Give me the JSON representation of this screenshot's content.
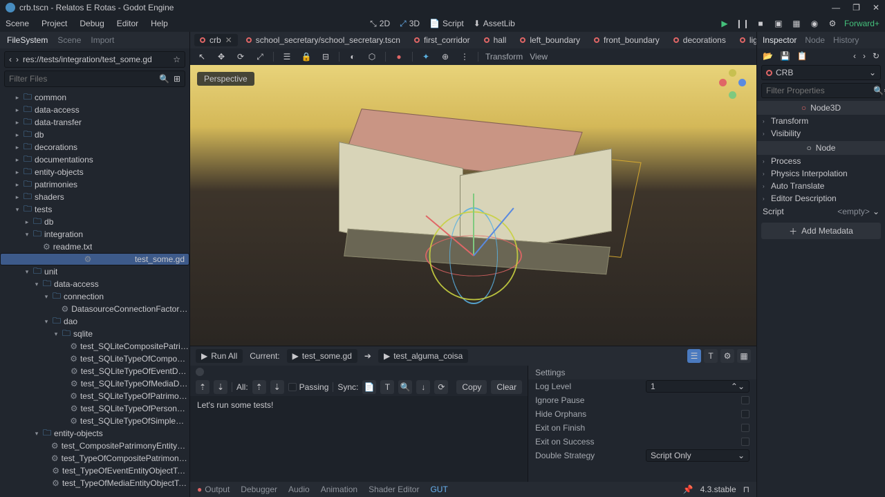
{
  "window_title": "crb.tscn - Relatos E Rotas - Godot Engine",
  "menubar": [
    "Scene",
    "Project",
    "Debug",
    "Editor",
    "Help"
  ],
  "workspace": {
    "items": [
      "2D",
      "3D",
      "Script",
      "AssetLib"
    ],
    "active": "3D"
  },
  "playbar": {
    "forward": "Forward+"
  },
  "left_dock": {
    "tabs": [
      "FileSystem",
      "Scene",
      "Import"
    ],
    "active": "FileSystem",
    "path": "res://tests/integration/test_some.gd",
    "filter_placeholder": "Filter Files"
  },
  "tree": [
    {
      "d": 1,
      "t": "folder",
      "o": false,
      "n": "common"
    },
    {
      "d": 1,
      "t": "folder",
      "o": false,
      "n": "data-access"
    },
    {
      "d": 1,
      "t": "folder",
      "o": false,
      "n": "data-transfer"
    },
    {
      "d": 1,
      "t": "folder",
      "o": false,
      "n": "db"
    },
    {
      "d": 1,
      "t": "folder",
      "o": false,
      "n": "decorations"
    },
    {
      "d": 1,
      "t": "folder",
      "o": false,
      "n": "documentations"
    },
    {
      "d": 1,
      "t": "folder",
      "o": false,
      "n": "entity-objects"
    },
    {
      "d": 1,
      "t": "folder",
      "o": false,
      "n": "patrimonies"
    },
    {
      "d": 1,
      "t": "folder",
      "o": false,
      "n": "shaders"
    },
    {
      "d": 1,
      "t": "folder",
      "o": true,
      "n": "tests"
    },
    {
      "d": 2,
      "t": "folder",
      "o": false,
      "n": "db"
    },
    {
      "d": 2,
      "t": "folder",
      "o": true,
      "n": "integration"
    },
    {
      "d": 3,
      "t": "file",
      "n": "readme.txt",
      "icon": "gear"
    },
    {
      "d": 3,
      "t": "file",
      "n": "test_some.gd",
      "icon": "gear",
      "sel": true
    },
    {
      "d": 2,
      "t": "folder",
      "o": true,
      "n": "unit"
    },
    {
      "d": 3,
      "t": "folder",
      "o": true,
      "n": "data-access"
    },
    {
      "d": 4,
      "t": "folder",
      "o": true,
      "n": "connection"
    },
    {
      "d": 5,
      "t": "file",
      "n": "DatasourceConnectionFactoryTest.gd",
      "icon": "gear"
    },
    {
      "d": 4,
      "t": "folder",
      "o": true,
      "n": "dao"
    },
    {
      "d": 5,
      "t": "folder",
      "o": true,
      "n": "sqlite"
    },
    {
      "d": 6,
      "t": "file",
      "n": "test_SQLiteCompositePatrimonyDAOT...",
      "icon": "gear"
    },
    {
      "d": 6,
      "t": "file",
      "n": "test_SQLiteTypeOfCompositePatrimon...",
      "icon": "gear"
    },
    {
      "d": 6,
      "t": "file",
      "n": "test_SQLiteTypeOfEventDAOTest.gd",
      "icon": "gear"
    },
    {
      "d": 6,
      "t": "file",
      "n": "test_SQLiteTypeOfMediaDAOTest.gd",
      "icon": "gear"
    },
    {
      "d": 6,
      "t": "file",
      "n": "test_SQLiteTypeOfPatrimonyDAOTest.gd",
      "icon": "gear"
    },
    {
      "d": 6,
      "t": "file",
      "n": "test_SQLiteTypeOfPersonDAOTest.gd",
      "icon": "gear"
    },
    {
      "d": 6,
      "t": "file",
      "n": "test_SQLiteTypeOfSimplePatrimonyDA...",
      "icon": "gear"
    },
    {
      "d": 3,
      "t": "folder",
      "o": true,
      "n": "entity-objects"
    },
    {
      "d": 4,
      "t": "file",
      "n": "test_CompositePatrimonyEntityObjectTest...",
      "icon": "gear"
    },
    {
      "d": 4,
      "t": "file",
      "n": "test_TypeOfCompositePatrimonyEntityObj...",
      "icon": "gear"
    },
    {
      "d": 4,
      "t": "file",
      "n": "test_TypeOfEventEntityObjectTest.gd",
      "icon": "gear"
    },
    {
      "d": 4,
      "t": "file",
      "n": "test_TypeOfMediaEntityObjectTest.gd",
      "icon": "gear"
    }
  ],
  "scene_tabs": [
    "crb",
    "school_secretary/school_secretary.tscn",
    "first_corridor",
    "hall",
    "left_boundary",
    "front_boundary",
    "decorations",
    "lighting"
  ],
  "scene_active": "crb",
  "toolbar_labels": {
    "transform": "Transform",
    "view": "View"
  },
  "perspective": "Perspective",
  "run": {
    "run_all": "Run All",
    "current": "Current:",
    "file1": "test_some.gd",
    "file2": "test_alguma_coisa"
  },
  "test_toolbar": {
    "all": "All:",
    "passing": "Passing",
    "sync": "Sync:",
    "copy": "Copy",
    "clear": "Clear"
  },
  "test_msg": "Let's run some tests!",
  "settings": {
    "header": "Settings",
    "log_level": "Log Level",
    "log_value": "1",
    "ignore_pause": "Ignore Pause",
    "hide_orphans": "Hide Orphans",
    "exit_finish": "Exit on Finish",
    "exit_success": "Exit on Success",
    "double_strategy": "Double Strategy",
    "double_value": "Script Only"
  },
  "bottombar": [
    "Output",
    "Debugger",
    "Audio",
    "Animation",
    "Shader Editor",
    "GUT"
  ],
  "bottombar_active": "GUT",
  "version": "4.3.stable",
  "inspector": {
    "tabs": [
      "Inspector",
      "Node",
      "History"
    ],
    "active": "Inspector",
    "node": "CRB",
    "filter_placeholder": "Filter Properties",
    "sec_node3d": "Node3D",
    "props1": [
      "Transform",
      "Visibility"
    ],
    "sec_node": "Node",
    "props2": [
      "Process",
      "Physics Interpolation",
      "Auto Translate",
      "Editor Description"
    ],
    "script_label": "Script",
    "script_value": "<empty>",
    "add_meta": "Add Metadata"
  }
}
